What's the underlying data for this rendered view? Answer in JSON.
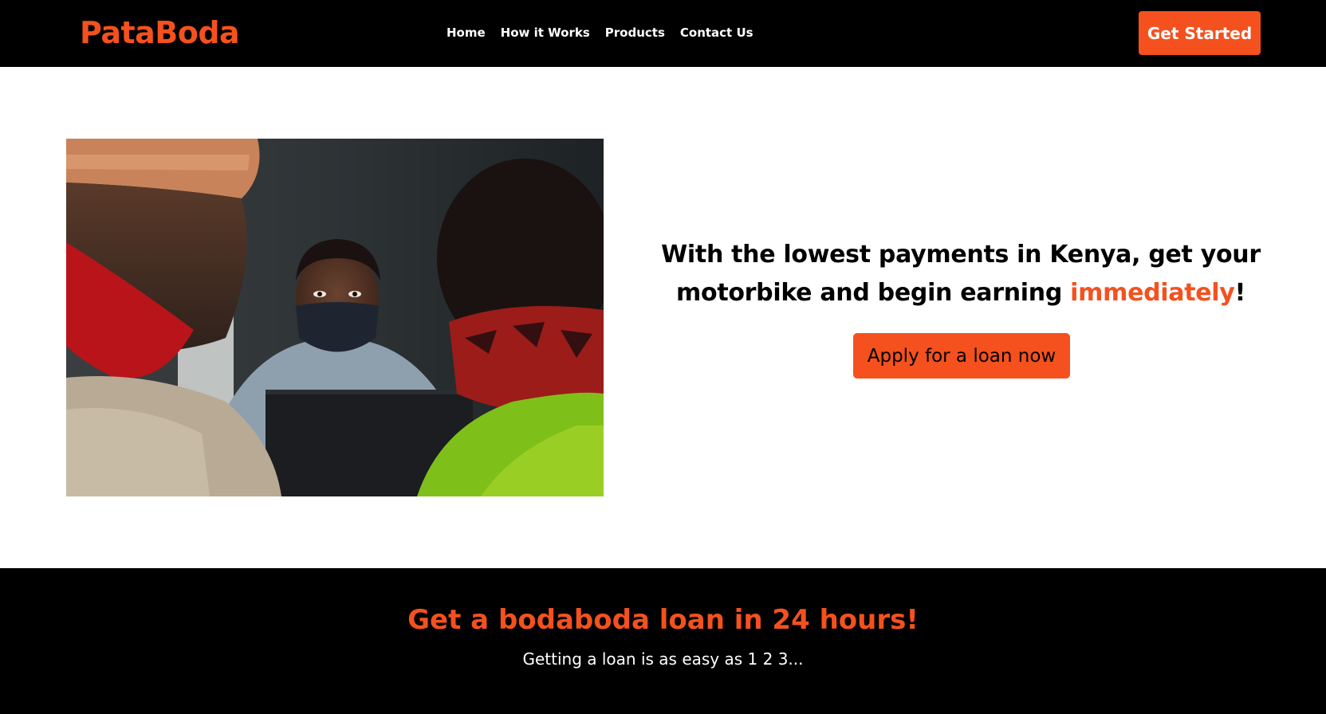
{
  "header": {
    "logo": "PataBoda",
    "nav": [
      {
        "label": "Home"
      },
      {
        "label": "How it Works"
      },
      {
        "label": "Products"
      },
      {
        "label": "Contact Us"
      }
    ],
    "cta_label": "Get Started"
  },
  "hero": {
    "headline_part1": "With the lowest payments in Kenya, get your motorbike and begin earning ",
    "headline_accent": "immediately",
    "headline_end": "!",
    "apply_label": "Apply for a loan now",
    "image_icon": "photo-loan-officer"
  },
  "steps": {
    "title": "Get a bodaboda loan in 24 hours!",
    "subtitle": "Getting a loan is as easy as 1 2 3..."
  },
  "colors": {
    "accent": "#f4511e",
    "dark": "#000000",
    "light": "#ffffff"
  }
}
